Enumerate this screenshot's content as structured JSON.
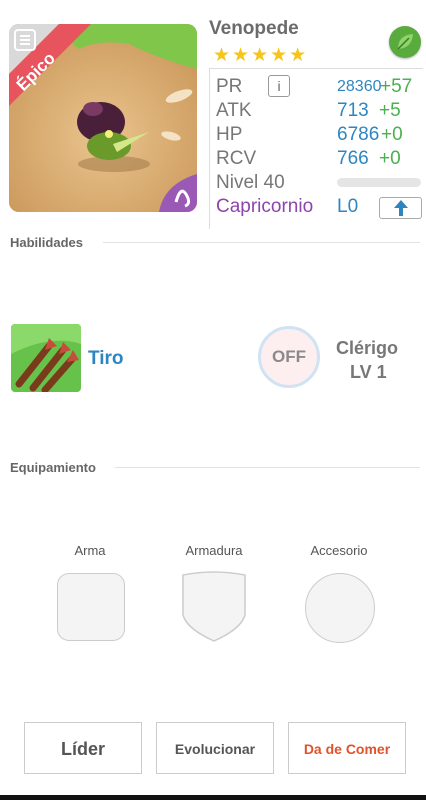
{
  "monster": {
    "name": "Venopede",
    "rarity": "Épico",
    "stars": "★★★★★",
    "element_icon": "leaf-icon",
    "sign_icon": "capricorn-icon"
  },
  "stats": {
    "pr": {
      "label": "PR",
      "value": "28360",
      "bonus": "+57"
    },
    "atk": {
      "label": "ATK",
      "value": "713",
      "bonus": "+5"
    },
    "hp": {
      "label": "HP",
      "value": "6786",
      "bonus": "+0"
    },
    "rcv": {
      "label": "RCV",
      "value": "766",
      "bonus": "+0"
    },
    "level": {
      "label": "Nivel 40",
      "xp_fraction": 0.0
    },
    "sign": {
      "label": "Capricornio",
      "value": "L0"
    }
  },
  "info_label": "i",
  "abilities": {
    "title": "Habilidades",
    "skill": {
      "name": "Tiro",
      "icon": "arrows-icon"
    },
    "passive": {
      "status": "OFF",
      "name": "Clérigo",
      "level": "LV 1"
    }
  },
  "equipment": {
    "title": "Equipamiento",
    "slots": [
      "Arma",
      "Armadura",
      "Accesorio"
    ]
  },
  "buttons": {
    "leader": "Líder",
    "evolve": "Evolucionar",
    "feed": "Da de Comer"
  },
  "colors": {
    "accent_blue": "#2e86c1",
    "bonus_green": "#4caf50",
    "sign_purple": "#8e44ad",
    "feed_red": "#e0522a"
  }
}
